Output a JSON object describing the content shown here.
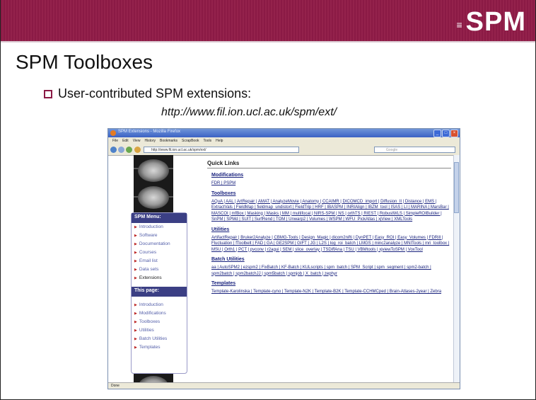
{
  "slide": {
    "logo": "SPM",
    "title": "SPM Toolboxes",
    "bullet": "User-contributed SPM extensions:",
    "url": "http://www.fil.ion.ucl.ac.uk/spm/ext/"
  },
  "browser": {
    "title": "SPM Extensions - Mozilla Firefox",
    "menu": [
      "File",
      "Edit",
      "View",
      "History",
      "Bookmarks",
      "ScrapBook",
      "Tools",
      "Help"
    ],
    "address": "http://www.fil.ion.ucl.ac.uk/spm/ext/",
    "search_placeholder": "Google",
    "status": "Done"
  },
  "page": {
    "spm_menu_header": "SPM Menu:",
    "spm_menu": [
      "Introduction",
      "Software",
      "Documentation",
      "Courses",
      "Email list",
      "Data sets",
      "Extensions"
    ],
    "this_page_header": "This page:",
    "this_page": [
      "Introduction",
      "Modifications",
      "Toolboxes",
      "Utilities",
      "Batch Utilities",
      "Templates"
    ],
    "quick_links": "Quick Links",
    "sections": [
      {
        "title": "Modifications",
        "links": "FDR | PSPM"
      },
      {
        "title": "Toolboxes",
        "links": "AQuA | AAL | ArtRepair | AMAT | AnalyzeMovie | Anatomy | CCAIMR | DICOMCD_import | Diffusion_II | Distance | EMS | ExtractVals | FieldMap | fieldmap_undistort | FieldTrip | HRF | IBASPM | INRIAlign | IBZM_tool | ISAS | LI | MARINA | MarsBar | MASCOI | mfBox | Masking | Masks | MM | multifocal | NIRS-SPM | NS | orthTS | RIEST | RobustWLS | SimpleROIBuilder | SnPM | SPMd | SUIT | SurfRend | TOM | Unwarp2 | Volumes | WSPM | WFU_PickAtlas | xjView | XMLTools"
      },
      {
        "title": "Utilities",
        "links": "ArtifactRepair | Bruker2Analyze | CBMG-Tools | Design_Magic | dicom2nifti | DynPET | Easy_ROI | Easy_Volumes | FDRill | Fluctuation | fToolbelt | FAD | GA | GE2SPM | GIFT | JG | L2S | log_roi_batch | LMGS | minc2analyze | MNITools | mri_toolbox | MSU | Orth1 | PCT | pvconv | r2agui | SEM | slice_overlay | TSDiffAna | TSU | VBMtools | xjviewToSPM | VoxTool"
      },
      {
        "title": "Batch Utilities",
        "links": "aa | AutoSPM2 | ezspm2 | FixBatch | KF-Batch | KULscripts | spm_batch | SPM_Script | spm_segment | spm2-batch | spm2batch | spm2batchJJ | spm5batch | spmjob | X_batch | zephyr"
      },
      {
        "title": "Templates",
        "links": "Template-Karolinska | Template-cyno | Template-N2K | Template-B2K | Template-CCHMCped | Brain-Atlases-2year | Zebra"
      }
    ]
  }
}
